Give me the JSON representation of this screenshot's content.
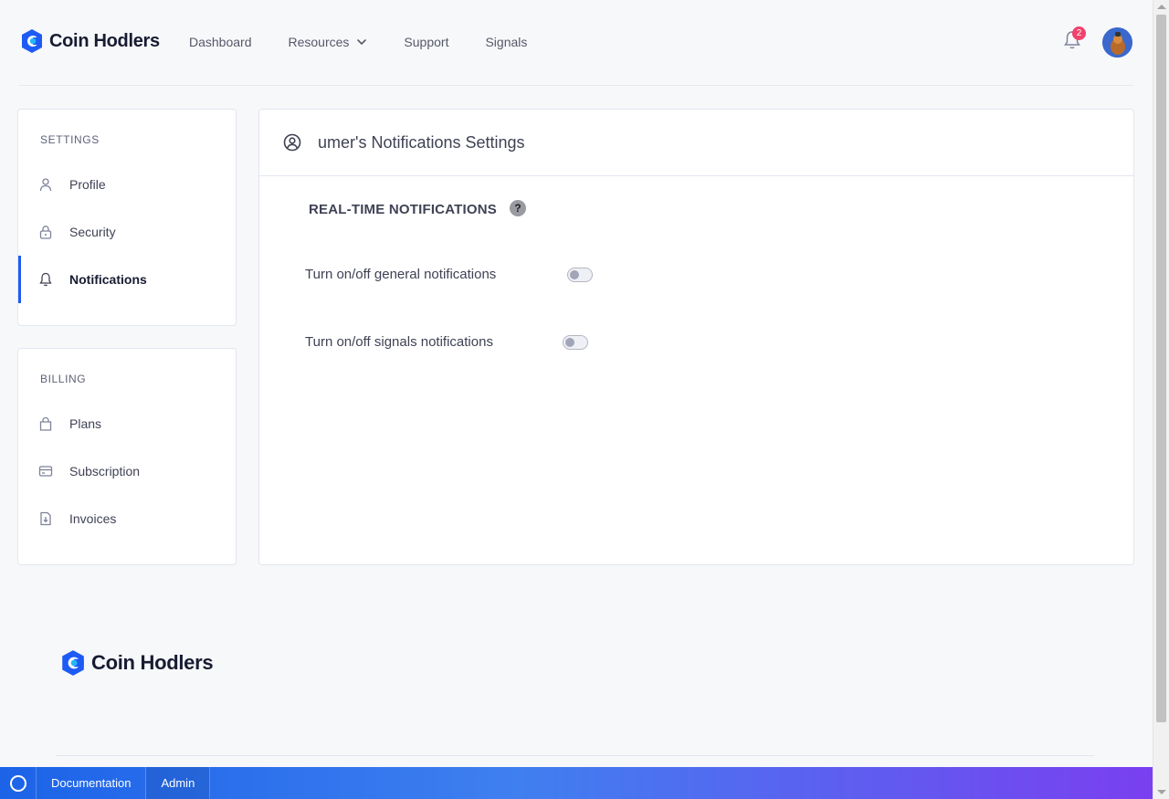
{
  "brand": {
    "name": "Coin Hodlers",
    "primary": "#1e5bf5",
    "accent": "#27b7f5"
  },
  "nav": {
    "items": [
      {
        "label": "Dashboard"
      },
      {
        "label": "Resources",
        "icon": "chevron-down-icon"
      },
      {
        "label": "Support"
      },
      {
        "label": "Signals"
      }
    ]
  },
  "notifications": {
    "count": "2",
    "icon": "bell-icon"
  },
  "sidebar": {
    "settings_title": "SETTINGS",
    "settings_items": [
      {
        "label": "Profile",
        "icon": "user-icon"
      },
      {
        "label": "Security",
        "icon": "lock-icon"
      },
      {
        "label": "Notifications",
        "icon": "bell-icon",
        "active": true
      }
    ],
    "billing_title": "BILLING",
    "billing_items": [
      {
        "label": "Plans",
        "icon": "bag-icon"
      },
      {
        "label": "Subscription",
        "icon": "credit-card-icon"
      },
      {
        "label": "Invoices",
        "icon": "file-download-icon"
      }
    ]
  },
  "main": {
    "title": "umer's Notifications Settings",
    "section_title": "REAL-TIME NOTIFICATIONS",
    "help_label": "?",
    "rows": [
      {
        "label": "Turn on/off general notifications",
        "enabled": false
      },
      {
        "label": "Turn on/off signals notifications",
        "enabled": false
      }
    ]
  },
  "footer": {
    "brand": "Coin Hodlers"
  },
  "bottombar": {
    "links": [
      {
        "label": "Documentation"
      },
      {
        "label": "Admin"
      }
    ]
  }
}
